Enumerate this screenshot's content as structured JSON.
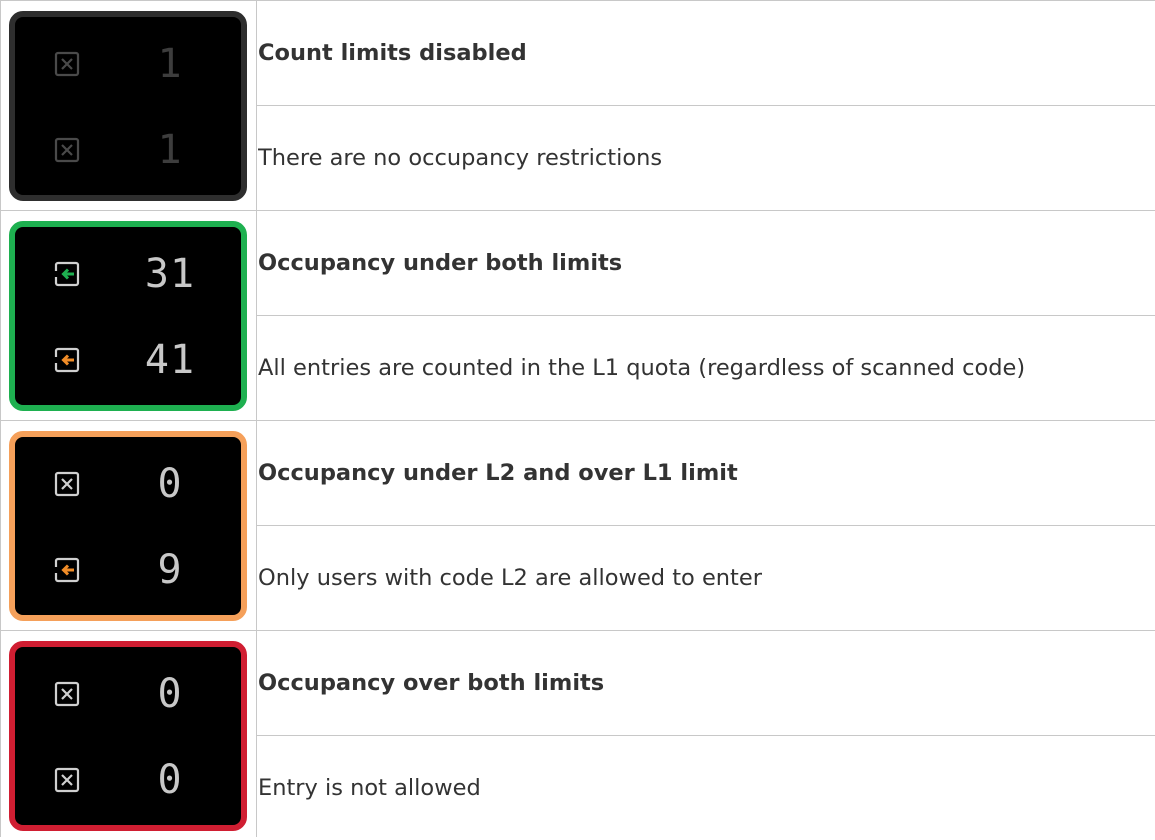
{
  "rows": [
    {
      "state": "disabled",
      "border_color": "#2e2e2e",
      "line1": {
        "icon": "cross-box-icon",
        "value": "1"
      },
      "line2": {
        "icon": "cross-box-icon",
        "value": "1"
      },
      "title": "Count limits disabled",
      "description": "There are no occupancy restrictions"
    },
    {
      "state": "under-both",
      "border_color": "#1eb050",
      "line1": {
        "icon": "enter-arrow-icon",
        "icon_color": "#1eb050",
        "value": "31"
      },
      "line2": {
        "icon": "enter-arrow-icon",
        "icon_color": "#f08c28",
        "value": "41"
      },
      "title": "Occupancy under both limits",
      "description": "All entries are counted in the L1 quota (regardless of scanned code)"
    },
    {
      "state": "under-l2-over-l1",
      "border_color": "#f5a05a",
      "line1": {
        "icon": "cross-box-icon",
        "value": "0"
      },
      "line2": {
        "icon": "enter-arrow-icon",
        "icon_color": "#f08c28",
        "value": "9"
      },
      "title": "Occupancy under L2 and over L1 limit",
      "description": "Only users with code L2 are allowed to enter"
    },
    {
      "state": "over-both",
      "border_color": "#d01e32",
      "line1": {
        "icon": "cross-box-icon",
        "value": "0"
      },
      "line2": {
        "icon": "cross-box-icon",
        "value": "0"
      },
      "title": "Occupancy over both limits",
      "description": "Entry is not allowed"
    }
  ]
}
